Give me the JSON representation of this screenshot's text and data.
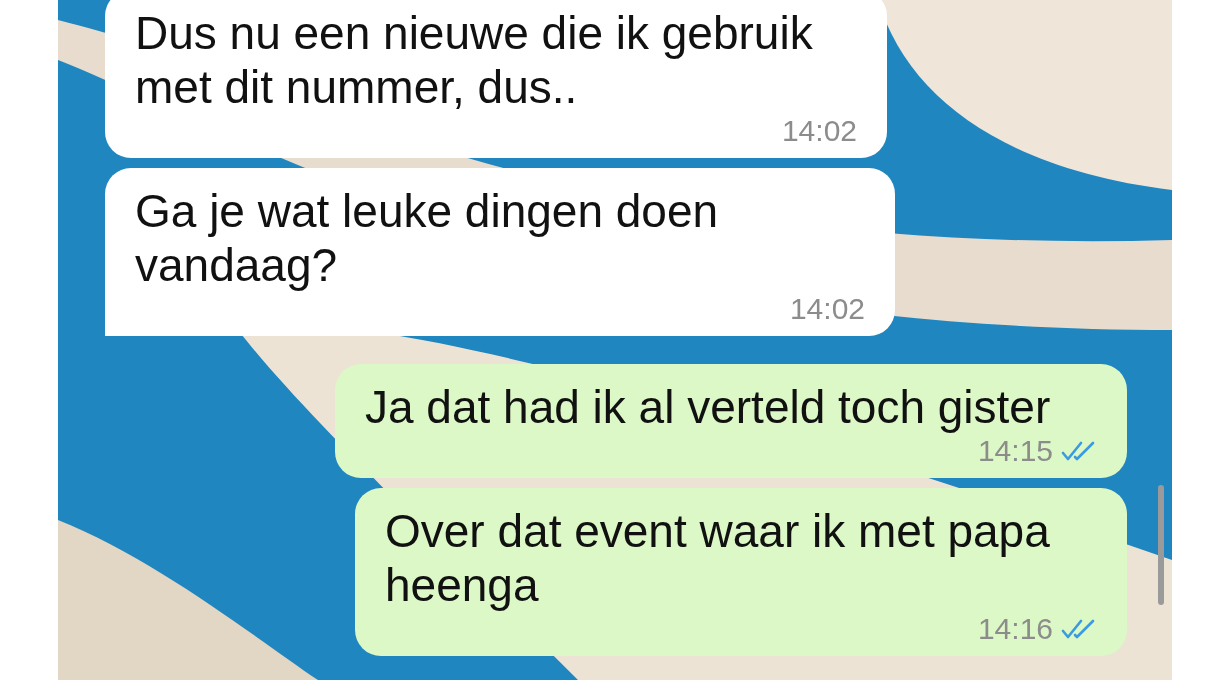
{
  "messages": [
    {
      "kind": "incoming",
      "text": "Dus nu een nieuwe die ik gebruik met dit nummer, dus..",
      "time": "14:02",
      "tail": false
    },
    {
      "kind": "incoming",
      "text": "Ga je wat leuke dingen doen vandaag?",
      "time": "14:02",
      "tail": true
    },
    {
      "kind": "outgoing",
      "text": "Ja dat had ik al verteld toch gister",
      "time": "14:15",
      "read": true,
      "tail": false
    },
    {
      "kind": "outgoing",
      "text": "Over dat event waar ik met papa heenga",
      "time": "14:16",
      "read": true,
      "tail": false
    }
  ]
}
